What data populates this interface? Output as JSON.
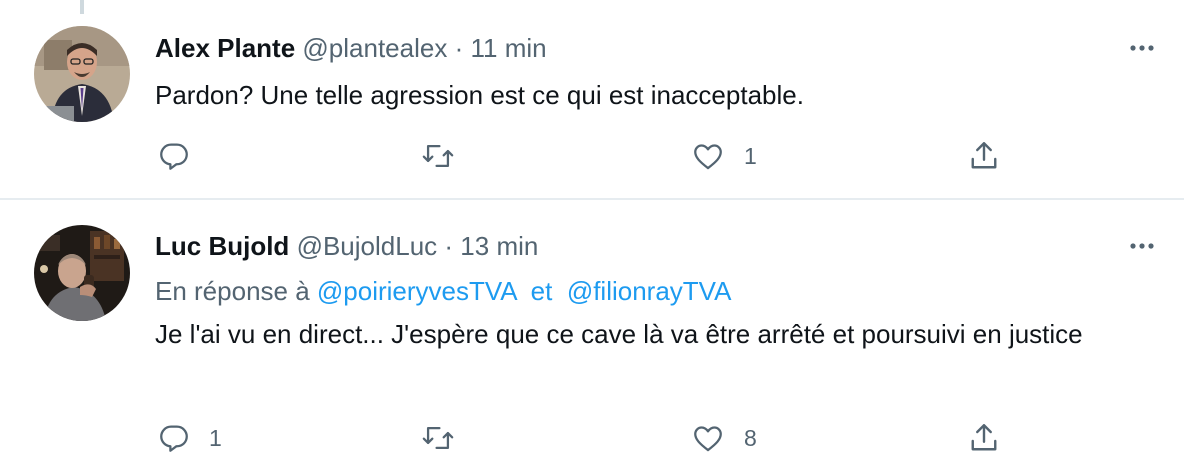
{
  "tweets": [
    {
      "name": "Alex Plante",
      "handle": "@plantealex",
      "separator": "·",
      "time": "11 min",
      "text": "Pardon? Une telle agression est ce qui est inacceptable.",
      "reply_count": "",
      "retweet_count": "",
      "like_count": "1"
    },
    {
      "name": "Luc Bujold",
      "handle": "@BujoldLuc",
      "separator": "·",
      "time": "13 min",
      "reply_prefix": "En réponse à",
      "reply_mention_1": "@poirieryvesTVA",
      "reply_conjunction": "et",
      "reply_mention_2": "@filionrayTVA",
      "text": "Je l'ai vu en direct... J'espère que ce cave là va être arrêté et poursuivi en justice",
      "reply_count": "1",
      "retweet_count": "",
      "like_count": "8"
    }
  ],
  "icons": {
    "reply": "reply-icon",
    "retweet": "retweet-icon",
    "like": "like-icon",
    "share": "share-icon",
    "more": "more-icon"
  },
  "colors": {
    "text": "#0f1419",
    "secondary": "#536471",
    "link": "#1d9bf0",
    "divider": "#e6ecf0"
  }
}
